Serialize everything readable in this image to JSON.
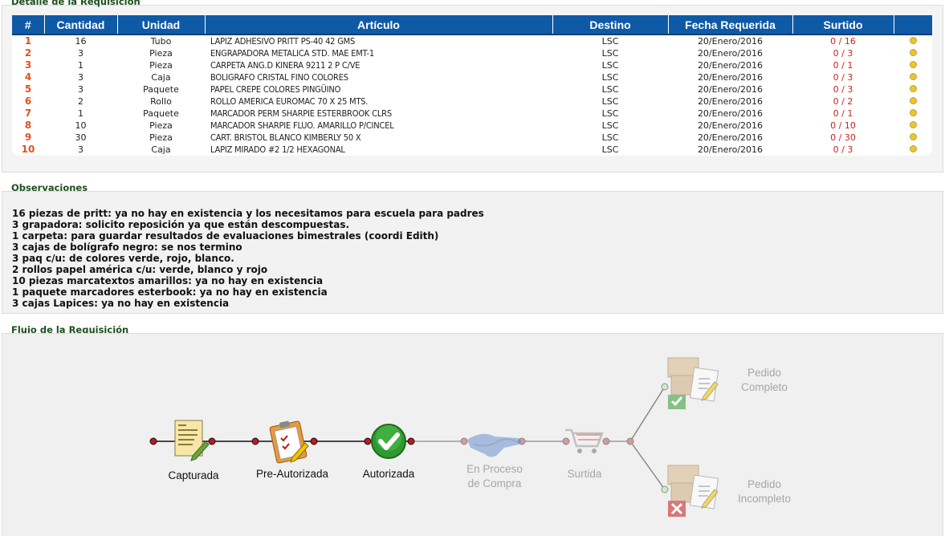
{
  "detail": {
    "title": "Detalle de la Requisición",
    "headers": [
      "#",
      "Cantidad",
      "Unidad",
      "Artículo",
      "Destino",
      "Fecha Requerida",
      "Surtido",
      ""
    ],
    "rows": [
      {
        "n": "1",
        "cantidad": "16",
        "unidad": "Tubo",
        "articulo": "LAPIZ ADHESIVO PRITT PS-40 42 GMS",
        "destino": "LSC",
        "fecha": "20/Enero/2016",
        "surtido": "0 / 16"
      },
      {
        "n": "2",
        "cantidad": "3",
        "unidad": "Pieza",
        "articulo": "ENGRAPADORA METALICA STD. MAE EMT-1",
        "destino": "LSC",
        "fecha": "20/Enero/2016",
        "surtido": "0 / 3"
      },
      {
        "n": "3",
        "cantidad": "1",
        "unidad": "Pieza",
        "articulo": "CARPETA ANG.D KINERA 9211 2 P C/VE",
        "destino": "LSC",
        "fecha": "20/Enero/2016",
        "surtido": "0 / 1"
      },
      {
        "n": "4",
        "cantidad": "3",
        "unidad": "Caja",
        "articulo": "BOLIGRAFO CRISTAL FINO COLORES",
        "destino": "LSC",
        "fecha": "20/Enero/2016",
        "surtido": "0 / 3"
      },
      {
        "n": "5",
        "cantidad": "3",
        "unidad": "Paquete",
        "articulo": "PAPEL CREPE COLORES PINGÜINO",
        "destino": "LSC",
        "fecha": "20/Enero/2016",
        "surtido": "0 / 3"
      },
      {
        "n": "6",
        "cantidad": "2",
        "unidad": "Rollo",
        "articulo": "ROLLO AMERICA EUROMAC 70 X 25 MTS.",
        "destino": "LSC",
        "fecha": "20/Enero/2016",
        "surtido": "0 / 2"
      },
      {
        "n": "7",
        "cantidad": "1",
        "unidad": "Paquete",
        "articulo": "MARCADOR PERM SHARPIE ESTERBROOK CLRS",
        "destino": "LSC",
        "fecha": "20/Enero/2016",
        "surtido": "0 / 1"
      },
      {
        "n": "8",
        "cantidad": "10",
        "unidad": "Pieza",
        "articulo": "MARCADOR SHARPIE FLUO. AMARILLO P/CINCEL",
        "destino": "LSC",
        "fecha": "20/Enero/2016",
        "surtido": "0 / 10"
      },
      {
        "n": "9",
        "cantidad": "30",
        "unidad": "Pieza",
        "articulo": "CART. BRISTOL BLANCO KIMBERLY 50 X",
        "destino": "LSC",
        "fecha": "20/Enero/2016",
        "surtido": "0 / 30"
      },
      {
        "n": "10",
        "cantidad": "3",
        "unidad": "Caja",
        "articulo": "LAPIZ MIRADO #2 1/2 HEXAGONAL",
        "destino": "LSC",
        "fecha": "20/Enero/2016",
        "surtido": "0 / 3"
      }
    ]
  },
  "observaciones": {
    "title": "Observaciones",
    "lines": [
      "16 piezas de pritt: ya no hay en existencia y los necesitamos para escuela para padres",
      "3 grapadora: solicito reposición ya que están descompuestas.",
      "1 carpeta: para guardar resultados de evaluaciones bimestrales (coordi Edith)",
      "3 cajas de bolígrafo negro: se nos termino",
      "3 paq c/u: de colores verde, rojo, blanco.",
      "2 rollos papel américa c/u: verde, blanco y rojo",
      "10 piezas marcatextos amarillos: ya no hay en existencia",
      "1 paquete marcadores esterbook: ya no hay en existencia",
      "3 cajas Lapices: ya no hay en existencia"
    ]
  },
  "flujo": {
    "title": "Flujo de la Requisición",
    "stages": {
      "capturada": "Capturada",
      "preautorizada": "Pre-Autorizada",
      "autorizada": "Autorizada",
      "proceso_line1": "En Proceso",
      "proceso_line2": "de Compra",
      "surtida": "Surtida",
      "completo_line1": "Pedido",
      "completo_line2": "Completo",
      "incompleto_line1": "Pedido",
      "incompleto_line2": "Incompleto"
    }
  },
  "colors": {
    "header_blue": "#0f5aa6",
    "row_number": "#e0521f",
    "surtido_red": "#cc2222",
    "status_dot": "#e7c43a",
    "node_active": "#c0181e",
    "node_inactive": "#c88080"
  },
  "icons": {
    "capturada": "document-pencil-icon",
    "preautorizada": "clipboard-checklist-icon",
    "autorizada": "green-check-icon",
    "proceso": "handshake-icon",
    "surtida": "shopping-cart-icon",
    "completo": "boxes-checklist-green-check-icon",
    "incompleto": "boxes-checklist-red-x-icon"
  }
}
